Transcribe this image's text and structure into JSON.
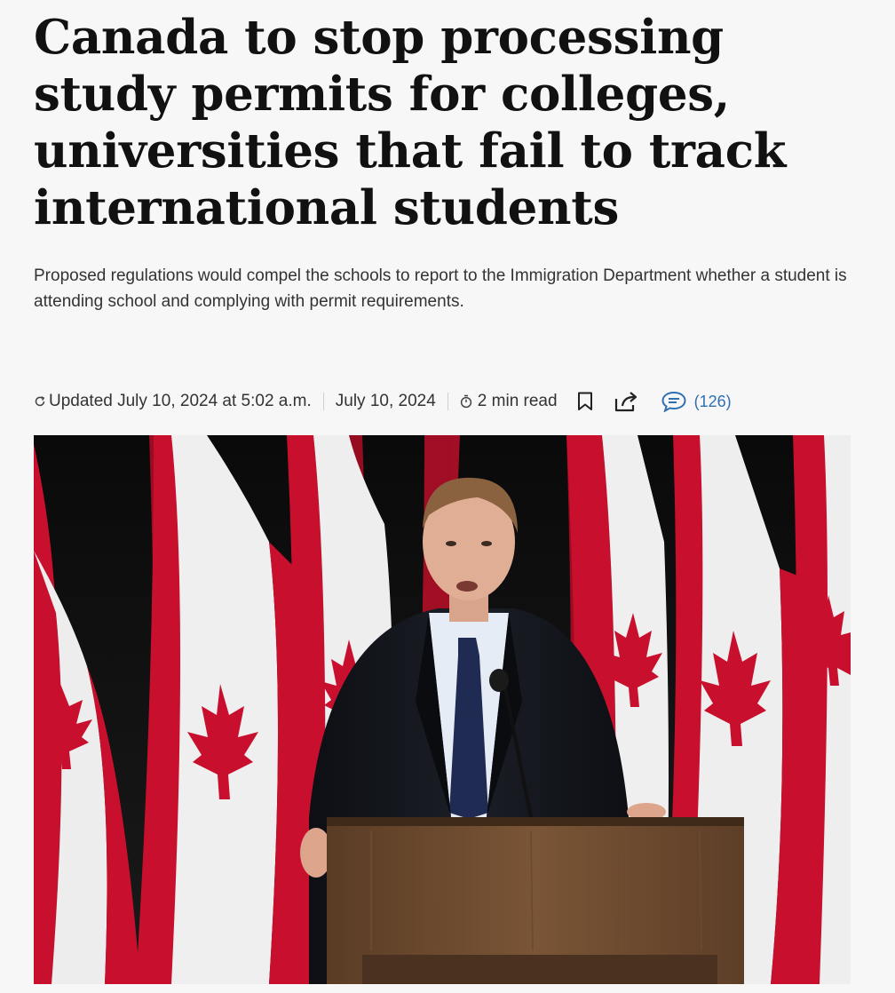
{
  "article": {
    "headline": "Canada to stop processing study permits for colleges, universities that fail to track international students",
    "dek": "Proposed regulations would compel the schools to report to the Immigration Department whether a student is attending school and complying with permit requirements.",
    "meta": {
      "updated": "Updated July 10, 2024 at 5:02 a.m.",
      "published": "July 10, 2024",
      "read_time": "2 min read",
      "comments_count": "(126)"
    },
    "icons": {
      "updated": "refresh-icon",
      "read_time": "timer-icon",
      "bookmark": "bookmark-icon",
      "share": "share-icon",
      "comments": "comment-bubble-icon"
    },
    "colors": {
      "headline": "#111111",
      "text": "#333333",
      "comments_accent": "#2f6fb0",
      "flag_red": "#c8102e",
      "background": "#f7f7f7"
    }
  }
}
